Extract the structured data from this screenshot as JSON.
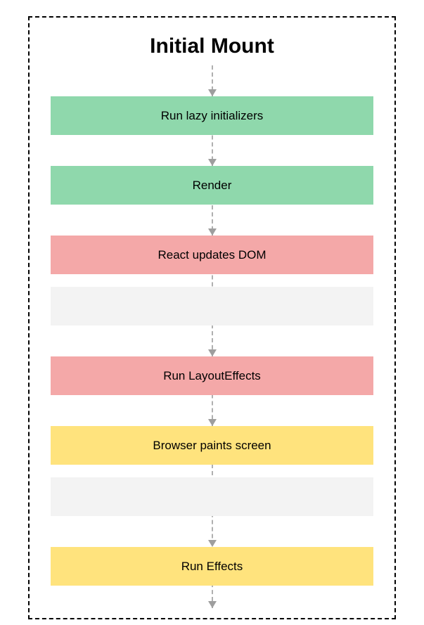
{
  "title": "Initial Mount",
  "steps": {
    "step1": {
      "label": "Run lazy initializers",
      "color": "green"
    },
    "step2": {
      "label": "Render",
      "color": "green"
    },
    "step3": {
      "label": "React updates DOM",
      "color": "red"
    },
    "step4": {
      "label": "",
      "color": "gray"
    },
    "step5": {
      "label": "Run LayoutEffects",
      "color": "red"
    },
    "step6": {
      "label": "Browser paints screen",
      "color": "yellow"
    },
    "step7": {
      "label": "",
      "color": "gray"
    },
    "step8": {
      "label": "Run Effects",
      "color": "yellow"
    }
  },
  "colors": {
    "green": "#8fd8ac",
    "red": "#f4a8a8",
    "gray": "#f3f3f3",
    "yellow": "#ffe37d"
  }
}
